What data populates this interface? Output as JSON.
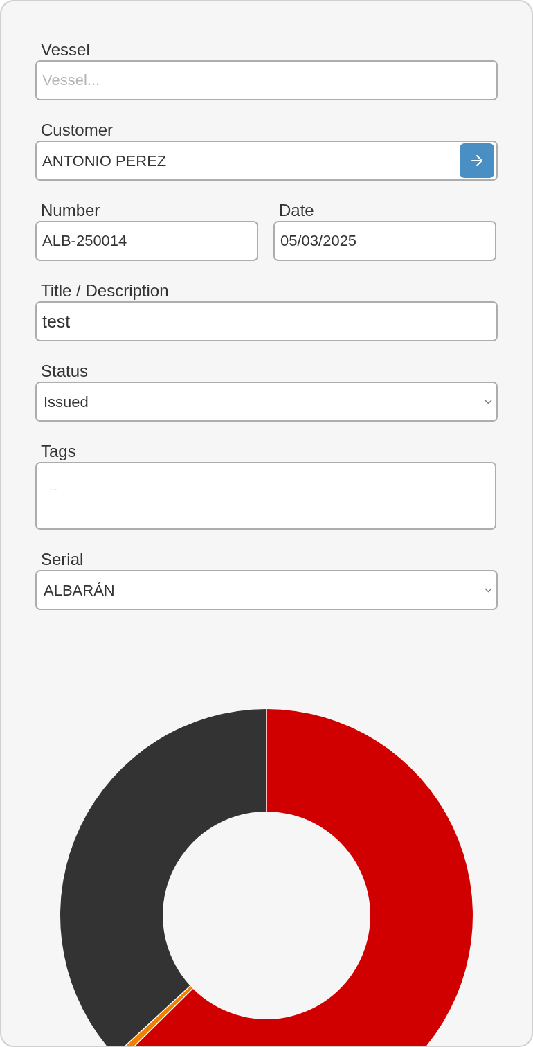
{
  "vessel": {
    "label": "Vessel",
    "placeholder": "Vessel..."
  },
  "customer": {
    "label": "Customer",
    "value": "ANTONIO PEREZ"
  },
  "number": {
    "label": "Number",
    "value": "ALB-250014"
  },
  "date": {
    "label": "Date",
    "value": "05/03/2025"
  },
  "title_description": {
    "label": "Title / Description",
    "value": "test"
  },
  "status": {
    "label": "Status",
    "value": "Issued"
  },
  "tags": {
    "label": "Tags",
    "placeholder": "..."
  },
  "serial": {
    "label": "Serial",
    "value": "ALBARÁN"
  }
}
